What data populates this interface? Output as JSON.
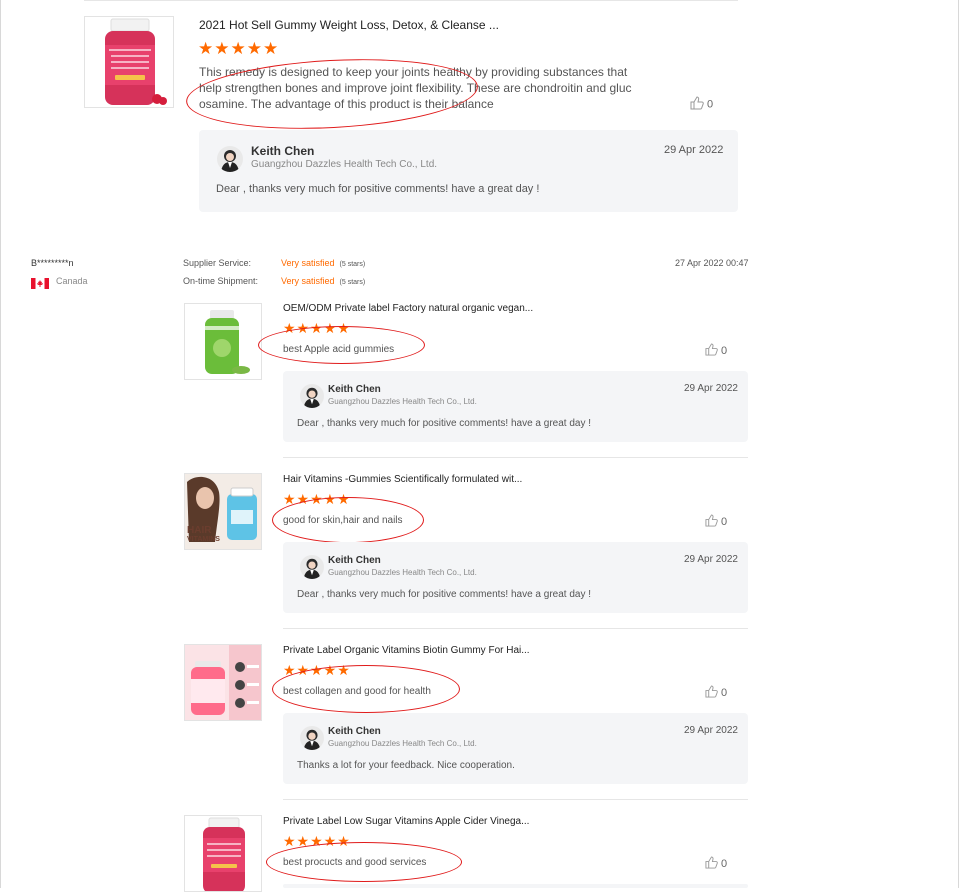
{
  "first_review": {
    "product_title": "2021 Hot Sell Gummy Weight Loss, Detox, & Cleanse ...",
    "stars": "★★★★★",
    "text_line1": "This remedy is designed to keep your joints healthy by providing substances that",
    "text_line2": "help strengthen bones and improve joint flexibility. These are chondroitin and gluc",
    "text_line3": "osamine. The advantage of this product is their balance",
    "likes": "0",
    "reply": {
      "name": "Keith Chen",
      "company": "Guangzhou Dazzles Health Tech Co., Ltd.",
      "date": "29 Apr 2022",
      "message": "Dear , thanks very much for positive comments! have a great day !"
    }
  },
  "buyer": {
    "name": "B*********n",
    "country": "Canada",
    "review_date": "27 Apr 2022 00:47",
    "supplier_service_label": "Supplier Service:",
    "supplier_service_value": "Very satisfied",
    "supplier_service_stars": "(5 stars)",
    "shipment_label": "On-time Shipment:",
    "shipment_value": "Very satisfied",
    "shipment_stars": "(5 stars)"
  },
  "items": [
    {
      "title": "OEM/ODM Private label Factory natural organic vegan...",
      "stars": "★★★★★",
      "text": "best Apple acid gummies",
      "likes": "0",
      "reply": {
        "name": "Keith Chen",
        "company": "Guangzhou Dazzles Health Tech Co., Ltd.",
        "date": "29 Apr 2022",
        "message": "Dear , thanks very much for positive comments! have a great day !"
      }
    },
    {
      "title": "Hair Vitamins -Gummies Scientifically formulated wit...",
      "stars": "★★★★★",
      "text": "good for skin,hair and nails",
      "likes": "0",
      "thumb_text_1": "HAIR",
      "thumb_text_2": "VITAMINS",
      "reply": {
        "name": "Keith Chen",
        "company": "Guangzhou Dazzles Health Tech Co., Ltd.",
        "date": "29 Apr 2022",
        "message": "Dear , thanks very much for positive comments! have a great day !"
      }
    },
    {
      "title": "Private Label Organic Vitamins Biotin Gummy For Hai...",
      "stars": "★★★★★",
      "text": "best collagen and good for health",
      "likes": "0",
      "reply": {
        "name": "Keith Chen",
        "company": "Guangzhou Dazzles Health Tech Co., Ltd.",
        "date": "29 Apr 2022",
        "message": "Thanks a lot for your feedback. Nice cooperation."
      }
    },
    {
      "title": "Private Label Low Sugar Vitamins Apple Cider Vinega...",
      "stars": "★★★★★",
      "text": "best procucts and good services",
      "likes": "0"
    }
  ],
  "colors": {
    "star": "#ff6a00",
    "annotation": "#e01b1b",
    "reply_bg": "#f4f5f7"
  }
}
